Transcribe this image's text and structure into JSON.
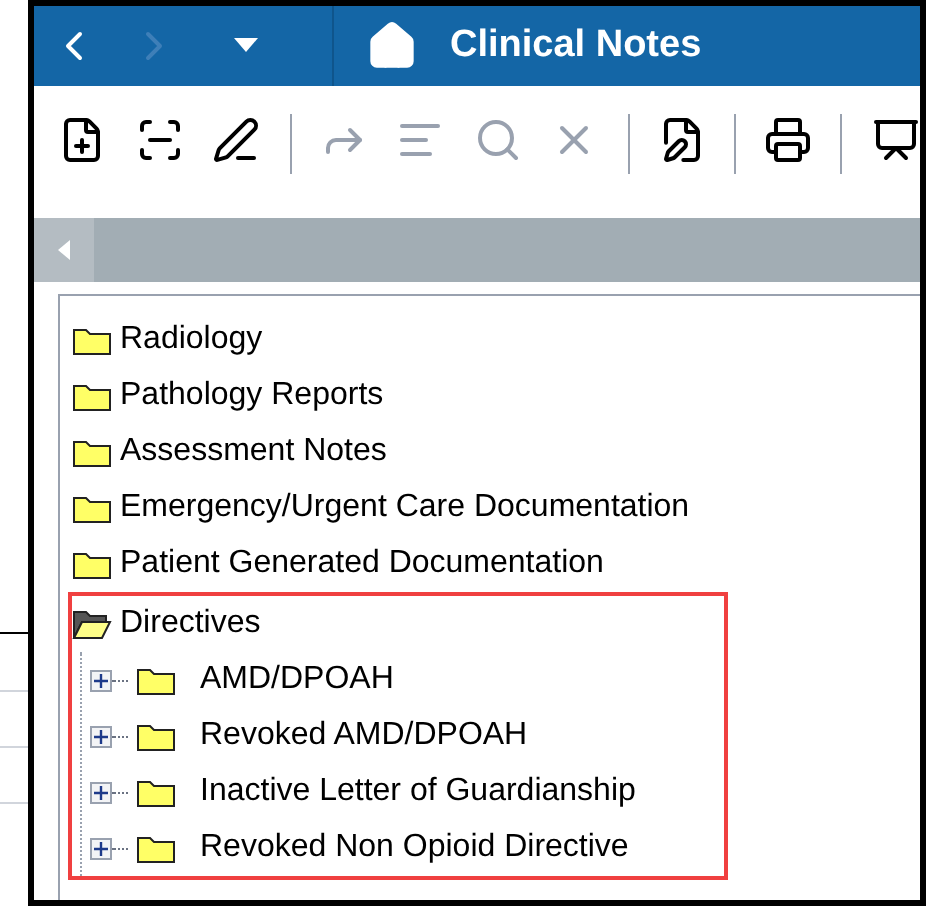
{
  "header": {
    "title": "Clinical Notes"
  },
  "toolbar": [
    {
      "kind": "new-note",
      "disabled": false
    },
    {
      "kind": "scan",
      "disabled": false
    },
    {
      "kind": "sign",
      "disabled": false
    },
    {
      "kind": "separator"
    },
    {
      "kind": "forward",
      "disabled": true
    },
    {
      "kind": "list",
      "disabled": true
    },
    {
      "kind": "search",
      "disabled": true
    },
    {
      "kind": "delete",
      "disabled": true
    },
    {
      "kind": "separator"
    },
    {
      "kind": "edit",
      "disabled": false
    },
    {
      "kind": "separator"
    },
    {
      "kind": "print",
      "disabled": false
    },
    {
      "kind": "separator"
    },
    {
      "kind": "chart",
      "disabled": false
    }
  ],
  "tree": [
    {
      "label": "Radiology",
      "expanded": false,
      "highlighted": false
    },
    {
      "label": "Pathology Reports",
      "expanded": false,
      "highlighted": false
    },
    {
      "label": "Assessment Notes",
      "expanded": false,
      "highlighted": false
    },
    {
      "label": "Emergency/Urgent Care Documentation",
      "expanded": false,
      "highlighted": false
    },
    {
      "label": "Patient Generated Documentation",
      "expanded": false,
      "highlighted": false
    },
    {
      "label": "Directives",
      "expanded": true,
      "highlighted": true,
      "children": [
        {
          "label": "AMD/DPOAH",
          "expanded": false
        },
        {
          "label": "Revoked AMD/DPOAH",
          "expanded": false
        },
        {
          "label": "Inactive Letter of Guardianship",
          "expanded": false
        },
        {
          "label": "Revoked Non Opioid Directive",
          "expanded": false
        }
      ]
    }
  ]
}
